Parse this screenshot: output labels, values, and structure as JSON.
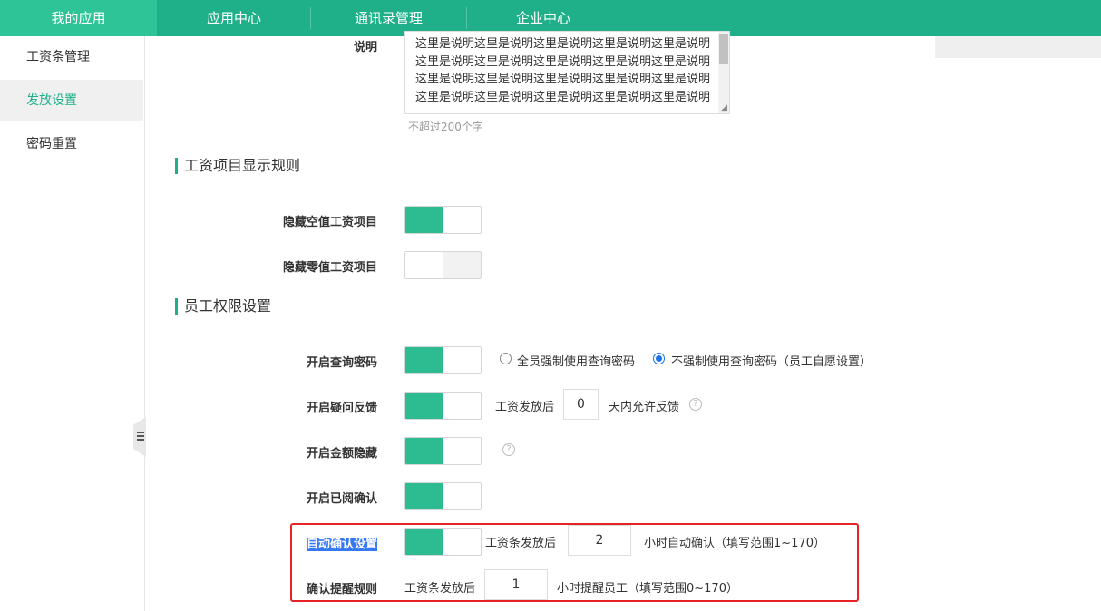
{
  "topnav": {
    "tabs": [
      {
        "label": "我的应用"
      },
      {
        "label": "应用中心"
      },
      {
        "label": "通讯录管理"
      },
      {
        "label": "企业中心"
      }
    ]
  },
  "sidebar": {
    "items": [
      {
        "label": "工资条管理"
      },
      {
        "label": "发放设置"
      },
      {
        "label": "密码重置"
      }
    ]
  },
  "description": {
    "label": "说明",
    "value": "这里是说明这里是说明这里是说明这里是说明这里是说明这里是说明这里是说明这里是说明这里是说明这里是说明这里是说明这里是说明这里是说明这里是说明这里是说明这里是说明这里是说明这里是说明这里是说明这里是说明",
    "hint": "不超过200个字"
  },
  "display_rules": {
    "title": "工资项目显示规则",
    "hide_empty_label": "隐藏空值工资项目",
    "hide_zero_label": "隐藏零值工资项目"
  },
  "permissions": {
    "title": "员工权限设置",
    "query_password": {
      "label": "开启查询密码",
      "option_force": "全员强制使用查询密码",
      "option_optional": "不强制使用查询密码（员工自愿设置）"
    },
    "feedback": {
      "label": "开启疑问反馈",
      "prefix": "工资发放后",
      "days": "0",
      "suffix": "天内允许反馈",
      "help": "?"
    },
    "amount_hide": {
      "label": "开启金额隐藏",
      "help": "?"
    },
    "read_confirm": {
      "label": "开启已阅确认"
    },
    "auto_confirm": {
      "label": "自动确认设置",
      "prefix": "工资条发放后",
      "hours": "2",
      "suffix": "小时自动确认（填写范围1~170）"
    },
    "reminder": {
      "label": "确认提醒规则",
      "prefix": "工资条发放后",
      "hours": "1",
      "suffix": "小时提醒员工（填写范围0~170）"
    }
  },
  "colors": {
    "brand": "#1fb08a",
    "toggle_on": "#2dbb92",
    "highlight": "#e62222",
    "selection": "#3478f6"
  }
}
